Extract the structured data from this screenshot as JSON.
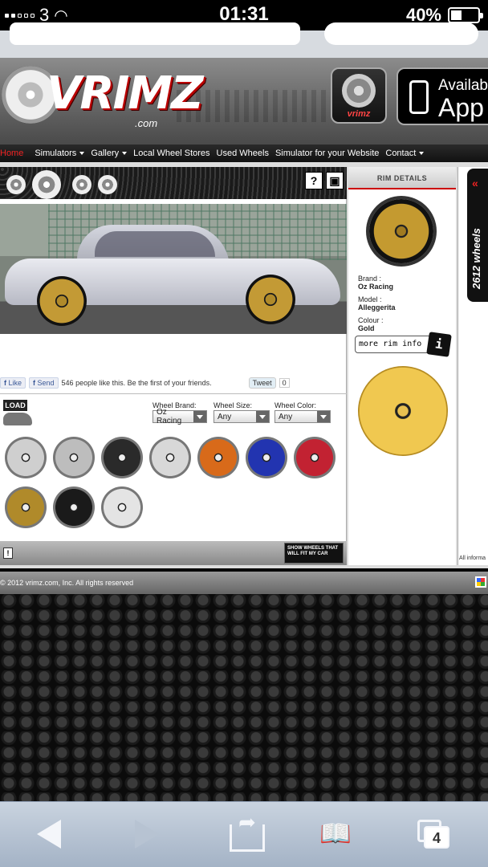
{
  "status_bar": {
    "carrier": "3",
    "time": "01:31",
    "battery": "40%",
    "battery_level": 0.4
  },
  "header": {
    "logo_text": "VRIMZ",
    "logo_domain": ".com",
    "app_icon_text": "vrimz",
    "appstore_line1": "Availab",
    "appstore_line2": "App"
  },
  "nav": {
    "items": [
      {
        "label": "Home",
        "has_caret": false
      },
      {
        "label": "Simulators",
        "has_caret": true
      },
      {
        "label": "Gallery",
        "has_caret": true
      },
      {
        "label": "Local Wheel Stores",
        "has_caret": false
      },
      {
        "label": "Used Wheels",
        "has_caret": false
      },
      {
        "label": "Simulator for your Website",
        "has_caret": false
      },
      {
        "label": "Contact",
        "has_caret": true
      }
    ]
  },
  "simulator": {
    "help_label": "?",
    "social": {
      "like": "Like",
      "send": "Send",
      "fb_text": "546 people like this. Be the first of your friends.",
      "tweet": "Tweet",
      "tweet_count": "0"
    },
    "load_label": "LOAD",
    "filters": {
      "brand_label": "Wheel Brand:",
      "brand_value": "Oz Racing",
      "size_label": "Wheel Size:",
      "size_value": "Any",
      "color_label": "Wheel Color:",
      "color_value": "Any"
    },
    "wheels": [
      {
        "color": "#cfcfcf"
      },
      {
        "color": "#bdbdbd"
      },
      {
        "color": "#2a2a2a"
      },
      {
        "color": "#d8d8d8"
      },
      {
        "color": "#d86a1a"
      },
      {
        "color": "#2234b0"
      },
      {
        "color": "#c22232"
      },
      {
        "color": "#b08a2a"
      },
      {
        "color": "#1a1a1a"
      },
      {
        "color": "#e4e4e4"
      }
    ],
    "footer_info": "!",
    "show_wheels_button": "SHOW WHEELS THAT WILL FIT MY CAR"
  },
  "rim_details": {
    "header": "RIM DETAILS",
    "brand_label": "Brand :",
    "brand": "Oz Racing",
    "model_label": "Model :",
    "model": "Alleggerita",
    "colour_label": "Colour :",
    "colour": "Gold",
    "more_button": "more rim info",
    "more_icon": "i"
  },
  "side_tab": {
    "chevron": "«",
    "text": "2612 wheels"
  },
  "all_info_text": "All informa",
  "footer": {
    "copyright": "© 2012 vrimz.com, Inc. All rights reserved"
  },
  "browser": {
    "tab_count": "4"
  },
  "colors": {
    "nav_active": "#e22222",
    "gold_wheel": "#c49a30"
  }
}
